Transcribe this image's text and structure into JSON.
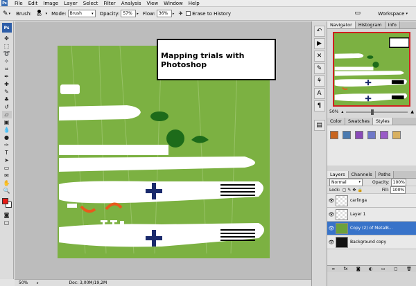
{
  "app": {
    "logo_text": "Ps"
  },
  "menu": [
    "File",
    "Edit",
    "Image",
    "Layer",
    "Select",
    "Filter",
    "Analysis",
    "View",
    "Window",
    "Help"
  ],
  "options": {
    "brush_label": "Brush:",
    "brush_size": "60",
    "mode_label": "Mode:",
    "mode_value": "Brush",
    "opacity_label": "Opacity:",
    "opacity_value": "57%",
    "flow_label": "Flow:",
    "flow_value": "36%",
    "erase_history_label": "Erase to History",
    "workspace_label": "Workspace"
  },
  "canvas": {
    "annotation": "Mapping trials with\nPhotoshop",
    "background_color": "#7cb142"
  },
  "status": {
    "zoom": "50%",
    "doc": "Doc: 3,00M/19,2M"
  },
  "navigator": {
    "tabs": [
      "Navigator",
      "Histogram",
      "Info"
    ],
    "zoom": "50%"
  },
  "swatches_panel": {
    "tabs": [
      "Color",
      "Swatches",
      "Styles"
    ],
    "style_colors": [
      "#c8641e",
      "#4a7ab0",
      "#8a4ab8",
      "#6f78c8",
      "#9a5ac8",
      "#d8b060"
    ]
  },
  "layers": {
    "tabs": [
      "Layers",
      "Channels",
      "Paths"
    ],
    "blend_mode": "Normal",
    "opacity_label": "Opacity:",
    "opacity_value": "100%",
    "lock_label": "Lock:",
    "fill_label": "Fill:",
    "fill_value": "100%",
    "rows": [
      {
        "name": "carlinga"
      },
      {
        "name": "Layer 1"
      },
      {
        "name": "Copy (2) of MetalB..."
      },
      {
        "name": "Background copy"
      }
    ]
  }
}
